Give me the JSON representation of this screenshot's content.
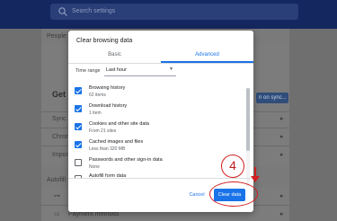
{
  "background": {
    "search_placeholder": "Search settings",
    "section_people": "People",
    "card_title_partial": "Get G",
    "sync_button_partial": "n on sync...",
    "row_sync": "Sync a",
    "row_chrome": "Chrom",
    "row_import": "Import",
    "section_autofill": "Autofill",
    "row_payment": "Payment methods"
  },
  "dialog": {
    "title": "Clear browsing data",
    "tabs": [
      {
        "label": "Basic",
        "selected": false
      },
      {
        "label": "Advanced",
        "selected": true
      }
    ],
    "time_range_label": "Time range",
    "time_range_value": "Last hour",
    "items": [
      {
        "title": "Browsing history",
        "subtitle": "62 items",
        "checked": true
      },
      {
        "title": "Download history",
        "subtitle": "1 item",
        "checked": true
      },
      {
        "title": "Cookies and other site data",
        "subtitle": "From 21 sites",
        "checked": true
      },
      {
        "title": "Cached images and files",
        "subtitle": "Less than 320 MB",
        "checked": true
      },
      {
        "title": "Passwords and other sign-in data",
        "subtitle": "None",
        "checked": false
      },
      {
        "title": "Autofill form data",
        "subtitle": "",
        "checked": false
      }
    ],
    "cancel_label": "Cancel",
    "clear_label": "Clear data"
  },
  "annotation": {
    "step_number": "4",
    "color": "#d21f1f"
  },
  "colors": {
    "accent": "#1a73e8",
    "topbar": "#14275e"
  }
}
